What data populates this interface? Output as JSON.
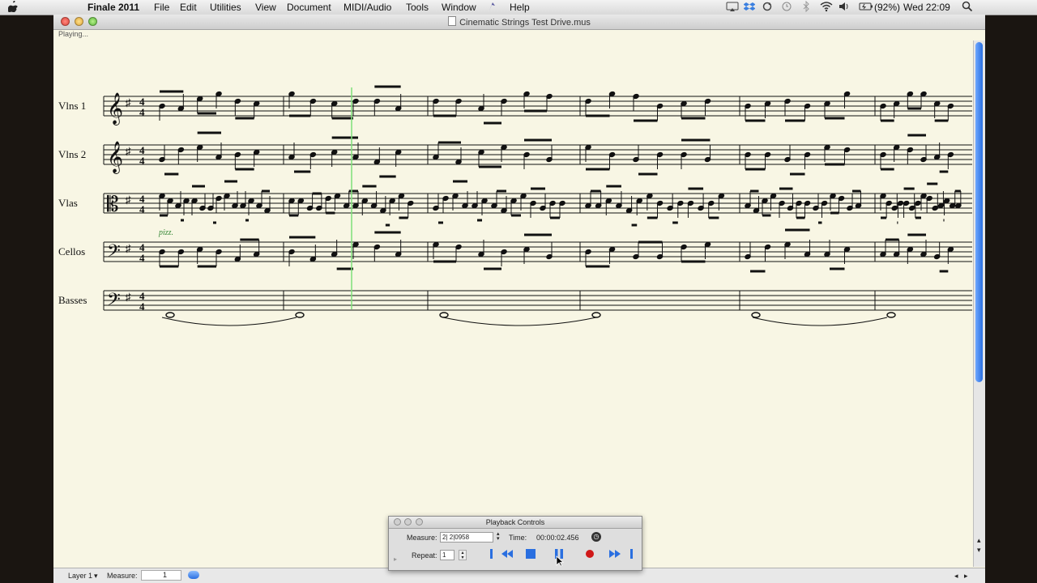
{
  "menubar": {
    "app_name": "Finale 2011",
    "items": [
      "File",
      "Edit",
      "Utilities",
      "View",
      "Document",
      "MIDI/Audio",
      "Tools",
      "Window",
      "Help"
    ],
    "battery": "(92%)",
    "clock": "Wed 22:09"
  },
  "window": {
    "title": "Cinematic Strings Test Drive.mus",
    "status": "Playing..."
  },
  "score": {
    "instruments": [
      "Vlns 1",
      "Vlns 2",
      "Vlas",
      "Cellos",
      "Basses"
    ],
    "time_signature": "4/4",
    "annotation": "pizz."
  },
  "bottom_bar": {
    "layer_label": "Layer 1",
    "measure_label": "Measure:",
    "measure_value": "1"
  },
  "playback": {
    "title": "Playback Controls",
    "measure_label": "Measure:",
    "measure_value": "2| 2|0958",
    "time_label": "Time:",
    "time_value": "00:00:02.456",
    "repeat_label": "Repeat:",
    "repeat_value": "1"
  },
  "colors": {
    "page": "#f8f6e4",
    "playback_cursor": "#7ee07a",
    "annotation": "#3a8a3a",
    "record": "#d01818",
    "transport": "#2a6fe0"
  }
}
